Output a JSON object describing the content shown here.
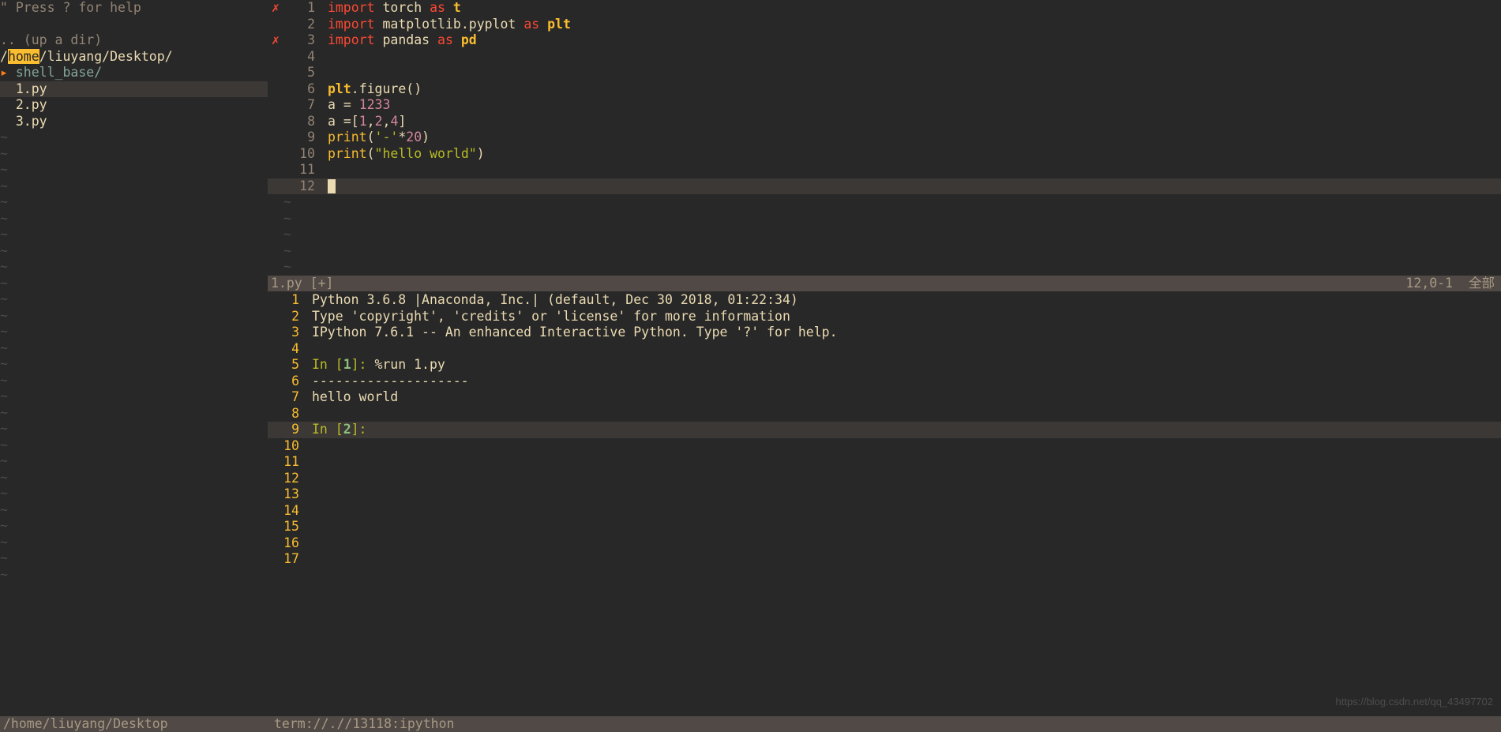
{
  "nerdtree": {
    "help": "\" Press ? for help",
    "updir": ".. (up a dir)",
    "path_prefix": "/",
    "path_home": "home",
    "path_rest": "/liuyang/Desktop/",
    "dir_arrow": "▸",
    "dir_name": " shell_base/",
    "files": [
      "1.py",
      "2.py",
      "3.py"
    ],
    "selected": 0
  },
  "editor": {
    "signs": {
      "1": "✗",
      "3": "✗"
    },
    "lines": [
      {
        "n": 1,
        "tokens": [
          [
            "kw",
            "import"
          ],
          [
            "sp",
            " "
          ],
          [
            "mod",
            "torch"
          ],
          [
            "sp",
            " "
          ],
          [
            "as",
            "as"
          ],
          [
            "sp",
            " "
          ],
          [
            "alias",
            "t"
          ]
        ]
      },
      {
        "n": 2,
        "tokens": [
          [
            "kw",
            "import"
          ],
          [
            "sp",
            " "
          ],
          [
            "mod",
            "matplotlib.pyplot"
          ],
          [
            "sp",
            " "
          ],
          [
            "as",
            "as"
          ],
          [
            "sp",
            " "
          ],
          [
            "alias",
            "plt"
          ]
        ]
      },
      {
        "n": 3,
        "tokens": [
          [
            "kw",
            "import"
          ],
          [
            "sp",
            " "
          ],
          [
            "mod",
            "pandas"
          ],
          [
            "sp",
            " "
          ],
          [
            "as",
            "as"
          ],
          [
            "sp",
            " "
          ],
          [
            "alias",
            "pd"
          ]
        ]
      },
      {
        "n": 4,
        "tokens": []
      },
      {
        "n": 5,
        "tokens": []
      },
      {
        "n": 6,
        "tokens": [
          [
            "alias",
            "plt"
          ],
          [
            "op",
            "."
          ],
          [
            "mod",
            "figure"
          ],
          [
            "op",
            "()"
          ]
        ]
      },
      {
        "n": 7,
        "tokens": [
          [
            "mod",
            "a "
          ],
          [
            "op",
            "= "
          ],
          [
            "num",
            "1233"
          ]
        ]
      },
      {
        "n": 8,
        "tokens": [
          [
            "mod",
            "a "
          ],
          [
            "op",
            "=["
          ],
          [
            "num",
            "1"
          ],
          [
            "op",
            ","
          ],
          [
            "num",
            "2"
          ],
          [
            "op",
            ","
          ],
          [
            "num",
            "4"
          ],
          [
            "op",
            "]"
          ]
        ]
      },
      {
        "n": 9,
        "tokens": [
          [
            "fn",
            "print"
          ],
          [
            "op",
            "("
          ],
          [
            "str",
            "'-'"
          ],
          [
            "op",
            "*"
          ],
          [
            "num",
            "20"
          ],
          [
            "op",
            ")"
          ]
        ]
      },
      {
        "n": 10,
        "tokens": [
          [
            "fn",
            "print"
          ],
          [
            "op",
            "("
          ],
          [
            "str",
            "\"hello world\""
          ],
          [
            "op",
            ")"
          ]
        ]
      },
      {
        "n": 11,
        "tokens": []
      },
      {
        "n": 12,
        "tokens": [
          [
            "cursor",
            ""
          ]
        ]
      }
    ],
    "tildes": 5,
    "status_file": "1.py [+]",
    "status_pos": "12,0-1",
    "status_all": "全部"
  },
  "terminal": {
    "lines": [
      {
        "n": 1,
        "text": "Python 3.6.8 |Anaconda, Inc.| (default, Dec 30 2018, 01:22:34) "
      },
      {
        "n": 2,
        "text": "Type 'copyright', 'credits' or 'license' for more information"
      },
      {
        "n": 3,
        "text": "IPython 7.6.1 -- An enhanced Interactive Python. Type '?' for help."
      },
      {
        "n": 4,
        "text": ""
      },
      {
        "n": 5,
        "prompt": {
          "in": "In [",
          "num": "1",
          "rest": "]: ",
          "cmd": "%run 1.py"
        }
      },
      {
        "n": 6,
        "text": "--------------------"
      },
      {
        "n": 7,
        "text": "hello world"
      },
      {
        "n": 8,
        "text": ""
      },
      {
        "n": 9,
        "hl": true,
        "prompt": {
          "in": "In [",
          "num": "2",
          "rest": "]: ",
          "cmd": ""
        }
      },
      {
        "n": 10,
        "text": ""
      },
      {
        "n": 11,
        "text": ""
      },
      {
        "n": 12,
        "text": ""
      },
      {
        "n": 13,
        "text": ""
      },
      {
        "n": 14,
        "text": ""
      },
      {
        "n": 15,
        "text": ""
      },
      {
        "n": 16,
        "text": ""
      },
      {
        "n": 17,
        "text": ""
      }
    ]
  },
  "bottombar": {
    "path": "/home/liuyang/Desktop",
    "term": "term://.//13118:ipython"
  },
  "watermark": "https://blog.csdn.net/qq_43497702"
}
